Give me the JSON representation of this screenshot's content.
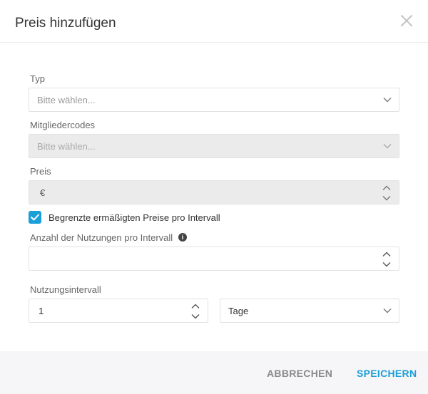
{
  "dialog": {
    "title": "Preis hinzufügen"
  },
  "form": {
    "typ": {
      "label": "Typ",
      "placeholder": "Bitte wählen..."
    },
    "mitgliedercodes": {
      "label": "Mitgliedercodes",
      "placeholder": "Bitte wählen..."
    },
    "preis": {
      "label": "Preis",
      "currency": "€"
    },
    "limit_checkbox": {
      "label": "Begrenzte ermäßigten Preise pro Intervall",
      "checked": true
    },
    "anzahl": {
      "label": "Anzahl der Nutzungen pro Intervall",
      "value": ""
    },
    "intervall": {
      "label": "Nutzungsintervall",
      "value": "1",
      "unit": "Tage"
    }
  },
  "footer": {
    "cancel_label": "ABBRECHEN",
    "save_label": "SPEICHERN"
  },
  "colors": {
    "accent": "#1a9fd9",
    "disabled_bg": "#ebebeb",
    "footer_bg": "#f6f6f8"
  }
}
